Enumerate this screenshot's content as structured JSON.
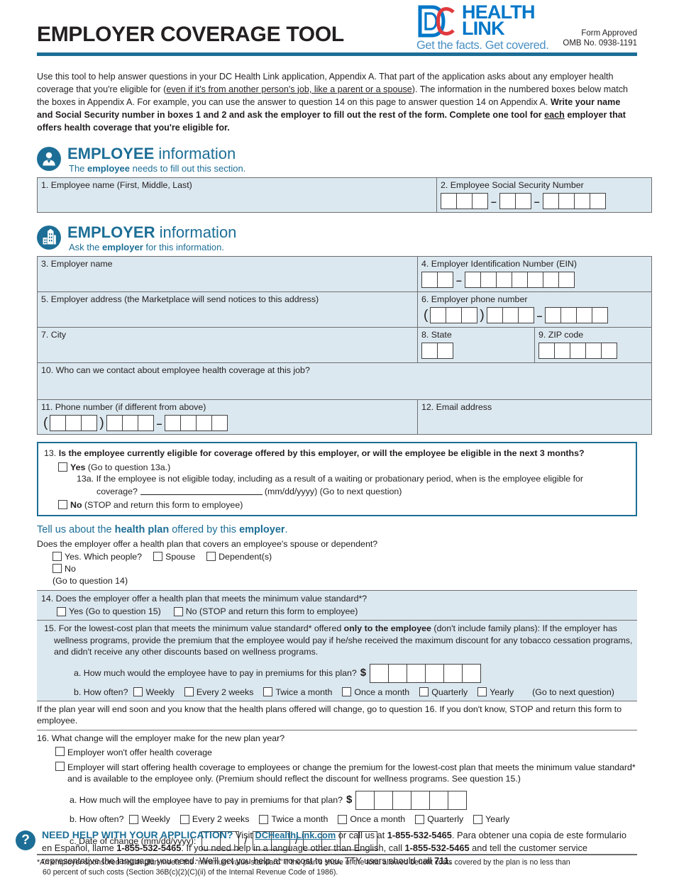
{
  "header": {
    "title": "EMPLOYER COVERAGE TOOL",
    "logo": {
      "mark_d": "D",
      "mark_c": "C",
      "word1": "HEALTH",
      "word2": "LINK",
      "tagline": "Get the facts. Get covered."
    },
    "form_approved": "Form Approved",
    "omb": "OMB No. 0938-1191"
  },
  "intro": {
    "part1": "Use this tool to help answer questions in your DC Health Link application, Appendix A. That part of the application asks about any employer health coverage that you're eligible for (",
    "underlined": "even if it's from another person's job, like a parent or a spouse",
    "part2": "). The information in the numbered boxes below match the boxes in Appendix A. For example, you can use the answer to question 14 on this page to answer question 14 on Appendix A. ",
    "bold1": "Write your name and Social Security number in boxes 1 and 2 and ask the employer to fill out the rest of the form. Complete one tool for ",
    "bold_underline": "each",
    "bold2": " employer that offers health coverage that you're eligible for."
  },
  "employee_section": {
    "icon": "person-icon",
    "title_strong": "EMPLOYEE",
    "title_rest": " information",
    "sub_pre": "The ",
    "sub_bold": "employee",
    "sub_post": " needs to fill out this section.",
    "field1_label": "1. Employee name (First, Middle, Last)",
    "field2_label": "2. Employee Social Security Number",
    "ssn_groups": [
      3,
      2,
      4
    ]
  },
  "employer_section": {
    "icon": "building-icon",
    "title_strong": "EMPLOYER",
    "title_rest": " information",
    "sub_pre": "Ask the ",
    "sub_bold": "employer",
    "sub_post": " for this information.",
    "field3_label": "3. Employer name",
    "field4_label": "4. Employer Identification Number (EIN)",
    "ein_groups": [
      2,
      7
    ],
    "field5_label": "5. Employer address (the Marketplace will send notices to this address)",
    "field6_label": "6. Employer phone number",
    "phone_groups": [
      3,
      3,
      4
    ],
    "field7_label": "7. City",
    "field8_label": "8. State",
    "state_boxes": 2,
    "field9_label": "9. ZIP code",
    "zip_boxes": 5,
    "field10_label": "10. Who can we contact about employee health coverage at this job?",
    "field11_label": "11. Phone number (if different from above)",
    "field12_label": "12. Email address"
  },
  "q13": {
    "number": "13.",
    "question": "Is the employee currently eligible for coverage offered by this employer, or will the employee be eligible in the next 3 months?",
    "yes_bold": "Yes",
    "yes_rest": "(Go to question 13a.)",
    "sub_label": "13a.",
    "sub_text": "If the employee is not eligible today, including as a result of a waiting or probationary period, when is the employee eligible for",
    "sub_text2_pre": "coverage?",
    "sub_text2_post": "(mm/dd/yyyy) (Go to next question)",
    "no_bold": "No",
    "no_rest": "(STOP and return this form to employee)"
  },
  "health_plan": {
    "heading_pre": "Tell us about the ",
    "heading_b1": "health plan",
    "heading_mid": " offered by this ",
    "heading_b2": "employer",
    "heading_post": ".",
    "question": "Does the employer offer a health plan that covers an employee's spouse or dependent?",
    "yes_label": "Yes. Which people?",
    "spouse_label": "Spouse",
    "dependent_label": "Dependent(s)",
    "no_label": "No",
    "goto": "(Go to question 14)"
  },
  "q14": {
    "question": "14. Does the employer offer a health plan that meets the minimum value standard*?",
    "yes_label": "Yes (Go to question 15)",
    "no_label": "No (STOP and return this form to employee)"
  },
  "q15": {
    "number": "15.",
    "text_pre": "For the lowest-cost plan that meets the minimum value standard* offered ",
    "text_bold": "only to the employee",
    "text_post": " (don't include family plans): If the employer has wellness programs, provide the premium that the employee would pay if he/she received the maximum discount for any tobacco cessation programs, and didn't receive any other discounts based on wellness programs.",
    "a_label": "a. How much would the employee have to pay in premiums for this plan?",
    "dollar": "$",
    "a_boxes": 6,
    "b_label": "b. How often?",
    "frequencies": [
      "Weekly",
      "Every 2 weeks",
      "Twice a month",
      "Once a month",
      "Quarterly",
      "Yearly"
    ],
    "b_tail": "(Go to next question)"
  },
  "plan_year_note": "If the plan year will end soon and you know that the health plans offered will change, go to question 16. If you don't know, STOP and return this form to employee.",
  "q16": {
    "question": "16. What change will the employer make for the new plan year?",
    "option1": "Employer won't offer health coverage",
    "option2": "Employer will start offering health coverage to employees or change the premium for the lowest-cost plan that meets the minimum value standard* and is available to the employee only. (Premium should reflect the discount for wellness programs. See question 15.)",
    "a_label": "a. How much will the employee have to pay in premiums for that plan?",
    "dollar": "$",
    "a_boxes": 6,
    "b_label": "b. How often?",
    "frequencies": [
      "Weekly",
      "Every 2 weeks",
      "Twice a month",
      "Once a month",
      "Quarterly",
      "Yearly"
    ],
    "c_label": "c. Date of change (mm/dd/yyyy):",
    "date_groups": [
      2,
      2,
      4
    ],
    "slash": "/"
  },
  "footnote": {
    "line1": "*An employer-sponsored health plan meets the “minimum value standard” if the plan's share of the total allowed benefit costs covered by the plan is no less than",
    "line2": "60 percent of such costs (Section 36B(c)(2)(C)(ii) of the Internal Revenue Code of 1986)."
  },
  "help": {
    "icon": "question-mark-icon",
    "headline": "NEED HELP WITH YOUR APPLICATION?",
    "visit": " Visit ",
    "link": "DCHealthLink.com",
    "or_call": " or call us at ",
    "phone1": "1-855-532-5465",
    "spanish": ". Para obtener una copia de este formulario en Español, llame ",
    "phone2": "1-855-532-5465",
    "other_lang": ". If you need help in a language other than English, call ",
    "phone3": "1-855-532-5465",
    "tail": " and tell the customer service representative the language you need. We'll get you help at no cost to you. TTY users should call ",
    "tty": "711",
    "period": "."
  },
  "colors": {
    "brand_blue": "#1c6e96",
    "logo_blue": "#0077c8",
    "logo_red": "#e03a3e",
    "field_bg": "#dce8ef",
    "rule": "#6d6e71"
  }
}
